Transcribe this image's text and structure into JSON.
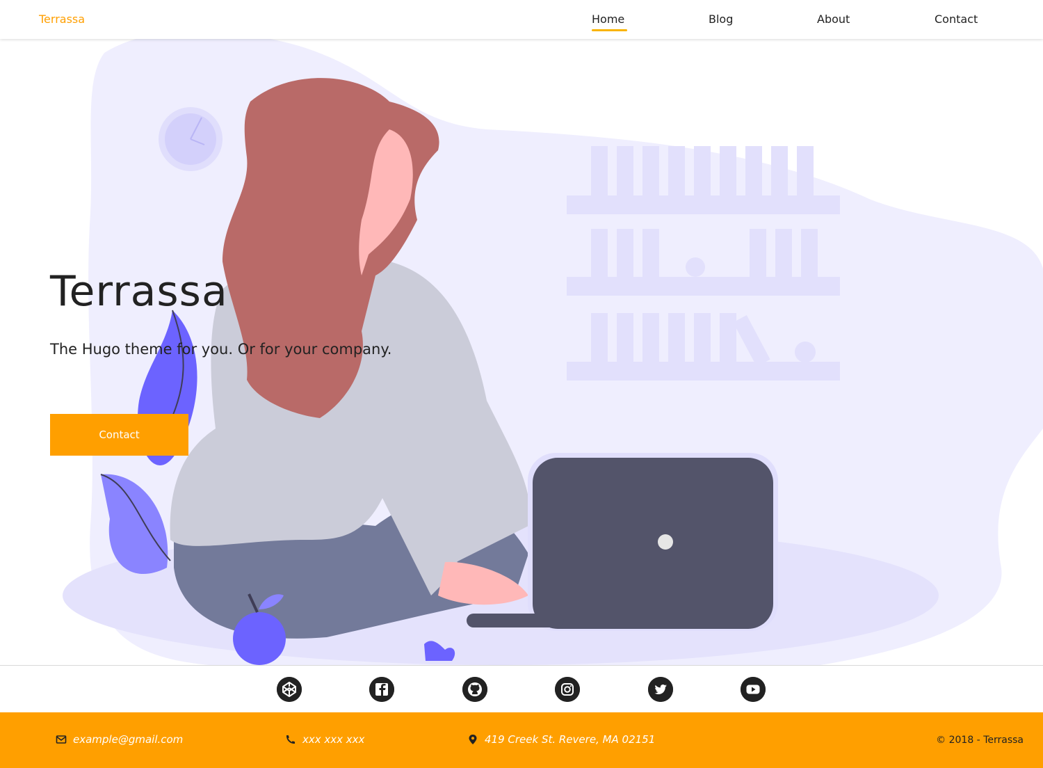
{
  "nav": {
    "brand": "Terrassa",
    "links": [
      {
        "label": "Home",
        "active": true
      },
      {
        "label": "Blog",
        "active": false
      },
      {
        "label": "About",
        "active": false
      },
      {
        "label": "Contact",
        "active": false
      }
    ]
  },
  "hero": {
    "title": "Terrassa",
    "subtitle": "The Hugo theme for you. Or for your company.",
    "button_label": "Contact"
  },
  "social": [
    {
      "icon": "codepen-icon"
    },
    {
      "icon": "facebook-icon"
    },
    {
      "icon": "github-icon"
    },
    {
      "icon": "instagram-icon"
    },
    {
      "icon": "twitter-icon"
    },
    {
      "icon": "youtube-icon"
    }
  ],
  "footer": {
    "email": "example@gmail.com",
    "phone": "xxx xxx xxx",
    "address": "419 Creek St. Revere, MA 02151",
    "copyright": "© 2018 - Terrassa"
  },
  "colors": {
    "accent": "#ff9f00",
    "nav_underline": "#f9b400",
    "illustration_bg": "#efeefe",
    "plant": "#6c63ff"
  }
}
